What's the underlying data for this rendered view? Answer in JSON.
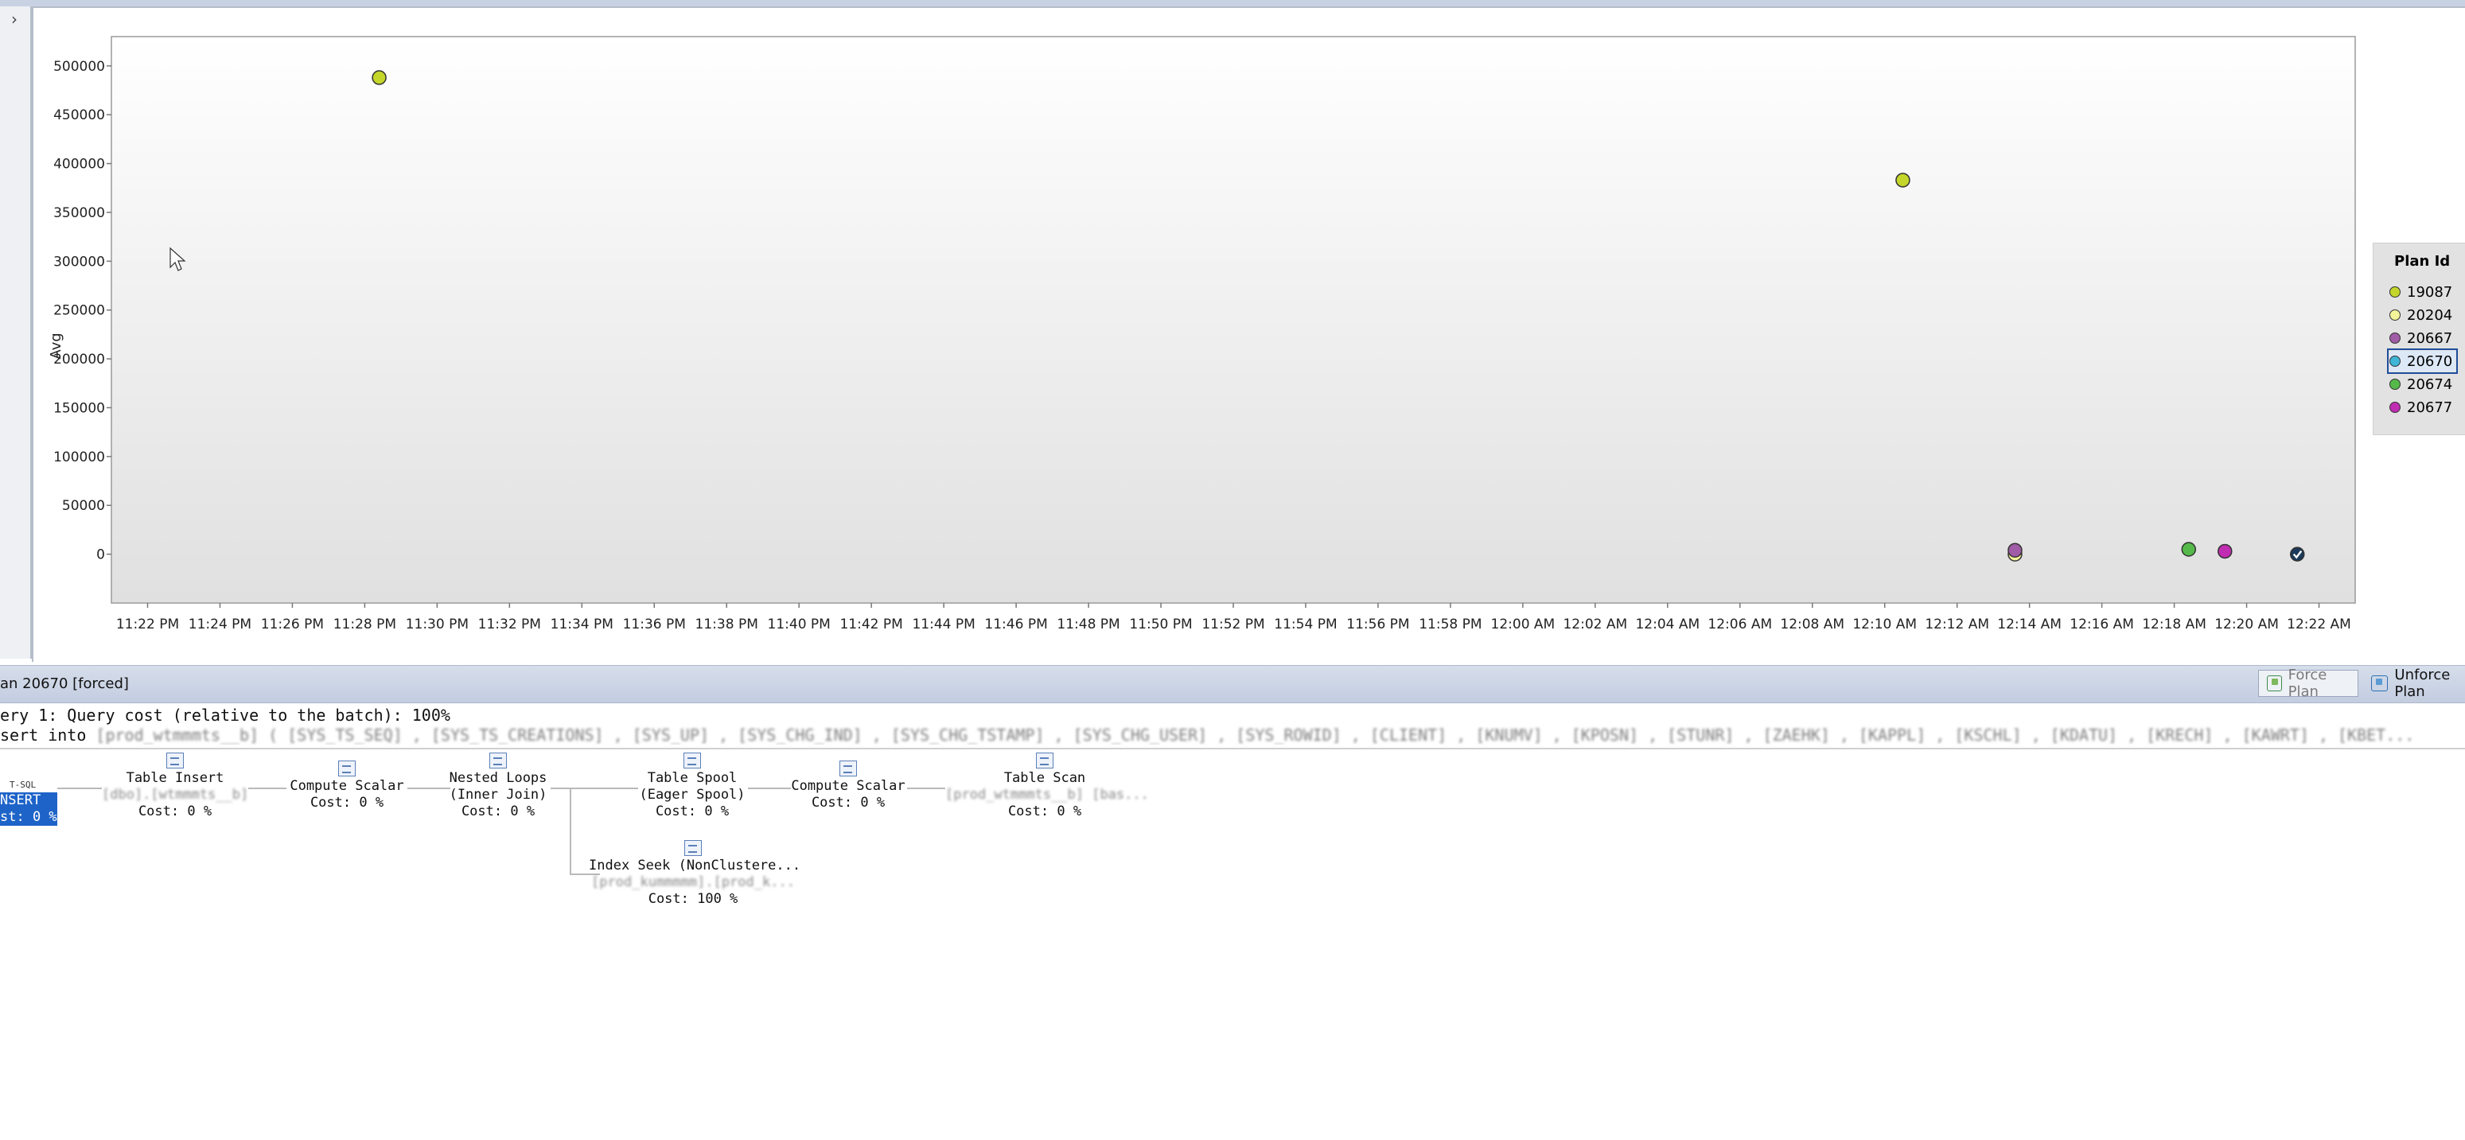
{
  "window": {
    "collapse_glyph": "›"
  },
  "chart_data": {
    "type": "scatter",
    "ylabel": "Avg",
    "ylim": [
      -50000,
      530000
    ],
    "y_ticks": [
      0,
      50000,
      100000,
      150000,
      200000,
      250000,
      300000,
      350000,
      400000,
      450000,
      500000
    ],
    "y_tick_labels": [
      "0",
      "50000",
      "100000",
      "150000",
      "200000",
      "250000",
      "300000",
      "350000",
      "400000",
      "450000",
      "500000"
    ],
    "x_tick_labels": [
      "11:22 PM",
      "11:24 PM",
      "11:26 PM",
      "11:28 PM",
      "11:30 PM",
      "11:32 PM",
      "11:34 PM",
      "11:36 PM",
      "11:38 PM",
      "11:40 PM",
      "11:42 PM",
      "11:44 PM",
      "11:46 PM",
      "11:48 PM",
      "11:50 PM",
      "11:52 PM",
      "11:54 PM",
      "11:56 PM",
      "11:58 PM",
      "12:00 AM",
      "12:02 AM",
      "12:04 AM",
      "12:06 AM",
      "12:08 AM",
      "12:10 AM",
      "12:12 AM",
      "12:14 AM",
      "12:16 AM",
      "12:18 AM",
      "12:20 AM",
      "12:22 AM"
    ],
    "x_tick_minutes": [
      0,
      2,
      4,
      6,
      8,
      10,
      12,
      14,
      16,
      18,
      20,
      22,
      24,
      26,
      28,
      30,
      32,
      34,
      36,
      38,
      40,
      42,
      44,
      46,
      48,
      50,
      52,
      54,
      56,
      58,
      60
    ],
    "x_tick_first": "11:22 PM",
    "xlim_minutes": [
      -1,
      61
    ],
    "grid": false,
    "legend_title": "Plan Id",
    "legend_position": "right",
    "series": [
      {
        "name": "19087",
        "color": "#c4d62a",
        "points": [
          {
            "x": "11:28 PM",
            "x_min": 6.4,
            "y": 488000
          },
          {
            "x": "12:10 AM",
            "x_min": 48.5,
            "y": 383000
          }
        ]
      },
      {
        "name": "20204",
        "color": "#f3f39a",
        "points": [
          {
            "x": "12:13 AM",
            "x_min": 51.6,
            "y": 0
          }
        ]
      },
      {
        "name": "20667",
        "color": "#a05ca6",
        "points": [
          {
            "x": "12:13 AM",
            "x_min": 51.6,
            "y": 4000
          }
        ]
      },
      {
        "name": "20670",
        "color": "#3fb5d8",
        "selected": true,
        "points": [
          {
            "x": "12:21 AM",
            "x_min": 59.4,
            "y": 0
          }
        ]
      },
      {
        "name": "20674",
        "color": "#55b94a",
        "points": [
          {
            "x": "12:18 AM",
            "x_min": 56.4,
            "y": 5000
          }
        ]
      },
      {
        "name": "20677",
        "color": "#c02cb2",
        "points": [
          {
            "x": "12:19 AM",
            "x_min": 57.4,
            "y": 3000
          }
        ]
      }
    ]
  },
  "plan_bar": {
    "title": "an 20670 [forced]",
    "force_plan": "Force Plan",
    "unforce_plan": "Unforce Plan"
  },
  "query": {
    "cost_line": "ery 1: Query cost (relative to the batch): 100%",
    "prefix": "sert into",
    "blurred_text": "[prod_wtmmmts__b] ( [SYS_TS_SEQ] , [SYS_TS_CREATIONS] , [SYS_UP] , [SYS_CHG_IND] , [SYS_CHG_TSTAMP] , [SYS_CHG_USER] , [SYS_ROWID] , [CLIENT] , [KNUMV] , [KPOSN] , [STUNR] , [ZAEHK] , [KAPPL] , [KSCHL] , [KDATU] , [KRECH] , [KAWRT] , [KBET..."
  },
  "plan": {
    "insert": {
      "tsql": "T-SQL",
      "line1": "NSERT",
      "line2": "st: 0 %"
    },
    "operators": [
      {
        "id": "table-insert",
        "line1": "Table Insert",
        "line2": "[dbo].[wtmmmts__b]",
        "line3": "Cost: 0 %"
      },
      {
        "id": "compute-scalar-1",
        "line1": "Compute Scalar",
        "line2": "Cost: 0 %"
      },
      {
        "id": "nested-loops",
        "line1": "Nested Loops",
        "line2": "(Inner Join)",
        "line3": "Cost: 0 %"
      },
      {
        "id": "table-spool",
        "line1": "Table Spool",
        "line2": "(Eager Spool)",
        "line3": "Cost: 0 %"
      },
      {
        "id": "compute-scalar-2",
        "line1": "Compute Scalar",
        "line2": "Cost: 0 %"
      },
      {
        "id": "table-scan",
        "line1": "Table Scan",
        "line2": "[prod_wtmmmts__b] [bas...",
        "line3": "Cost: 0 %"
      },
      {
        "id": "index-seek",
        "line1": "Index Seek (NonClustere...",
        "line2": "[prod_kummmmm].[prod_k...",
        "line3": "Cost: 100 %"
      }
    ]
  }
}
